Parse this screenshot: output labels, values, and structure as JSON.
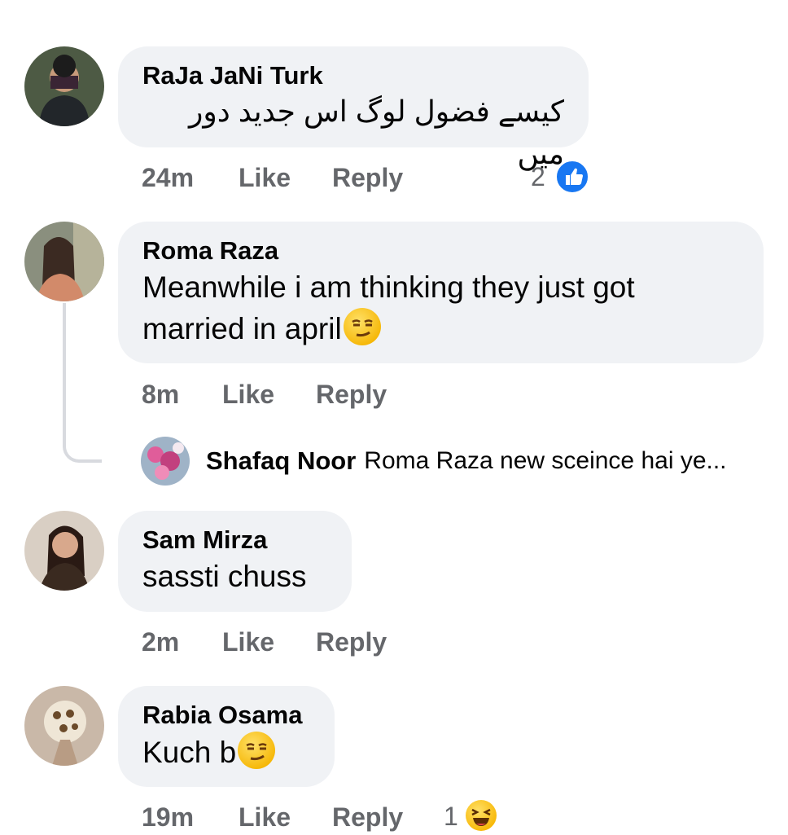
{
  "comments": [
    {
      "author": "RaJa JaNi Turk",
      "text": "کیسے فضول لوگ اس جدید دور میں",
      "time": "24m",
      "like_label": "Like",
      "reply_label": "Reply",
      "reaction_count": "2",
      "reaction_icon": "like-icon"
    },
    {
      "author": "Roma Raza",
      "text_line1": "Meanwhile i am thinking they just got",
      "text_line2": "married in april",
      "emoji": "smirk-face-icon",
      "time": "8m",
      "like_label": "Like",
      "reply_label": "Reply",
      "reply_preview": {
        "author": "Shafaq Noor",
        "text": "Roma Raza new sceince hai ye..."
      }
    },
    {
      "author": "Sam Mirza",
      "text": "sassti chuss",
      "time": "2m",
      "like_label": "Like",
      "reply_label": "Reply"
    },
    {
      "author": "Rabia Osama",
      "text": "Kuch b",
      "emoji": "smirk-face-icon",
      "time": "19m",
      "like_label": "Like",
      "reply_label": "Reply",
      "reaction_count": "1",
      "reaction_icon": "laughing-face-icon"
    }
  ],
  "colors": {
    "bubble": "#f0f2f5",
    "meta_text": "#65676b",
    "like_blue": "#1877f2",
    "emoji_yellow": "#f7b500"
  }
}
